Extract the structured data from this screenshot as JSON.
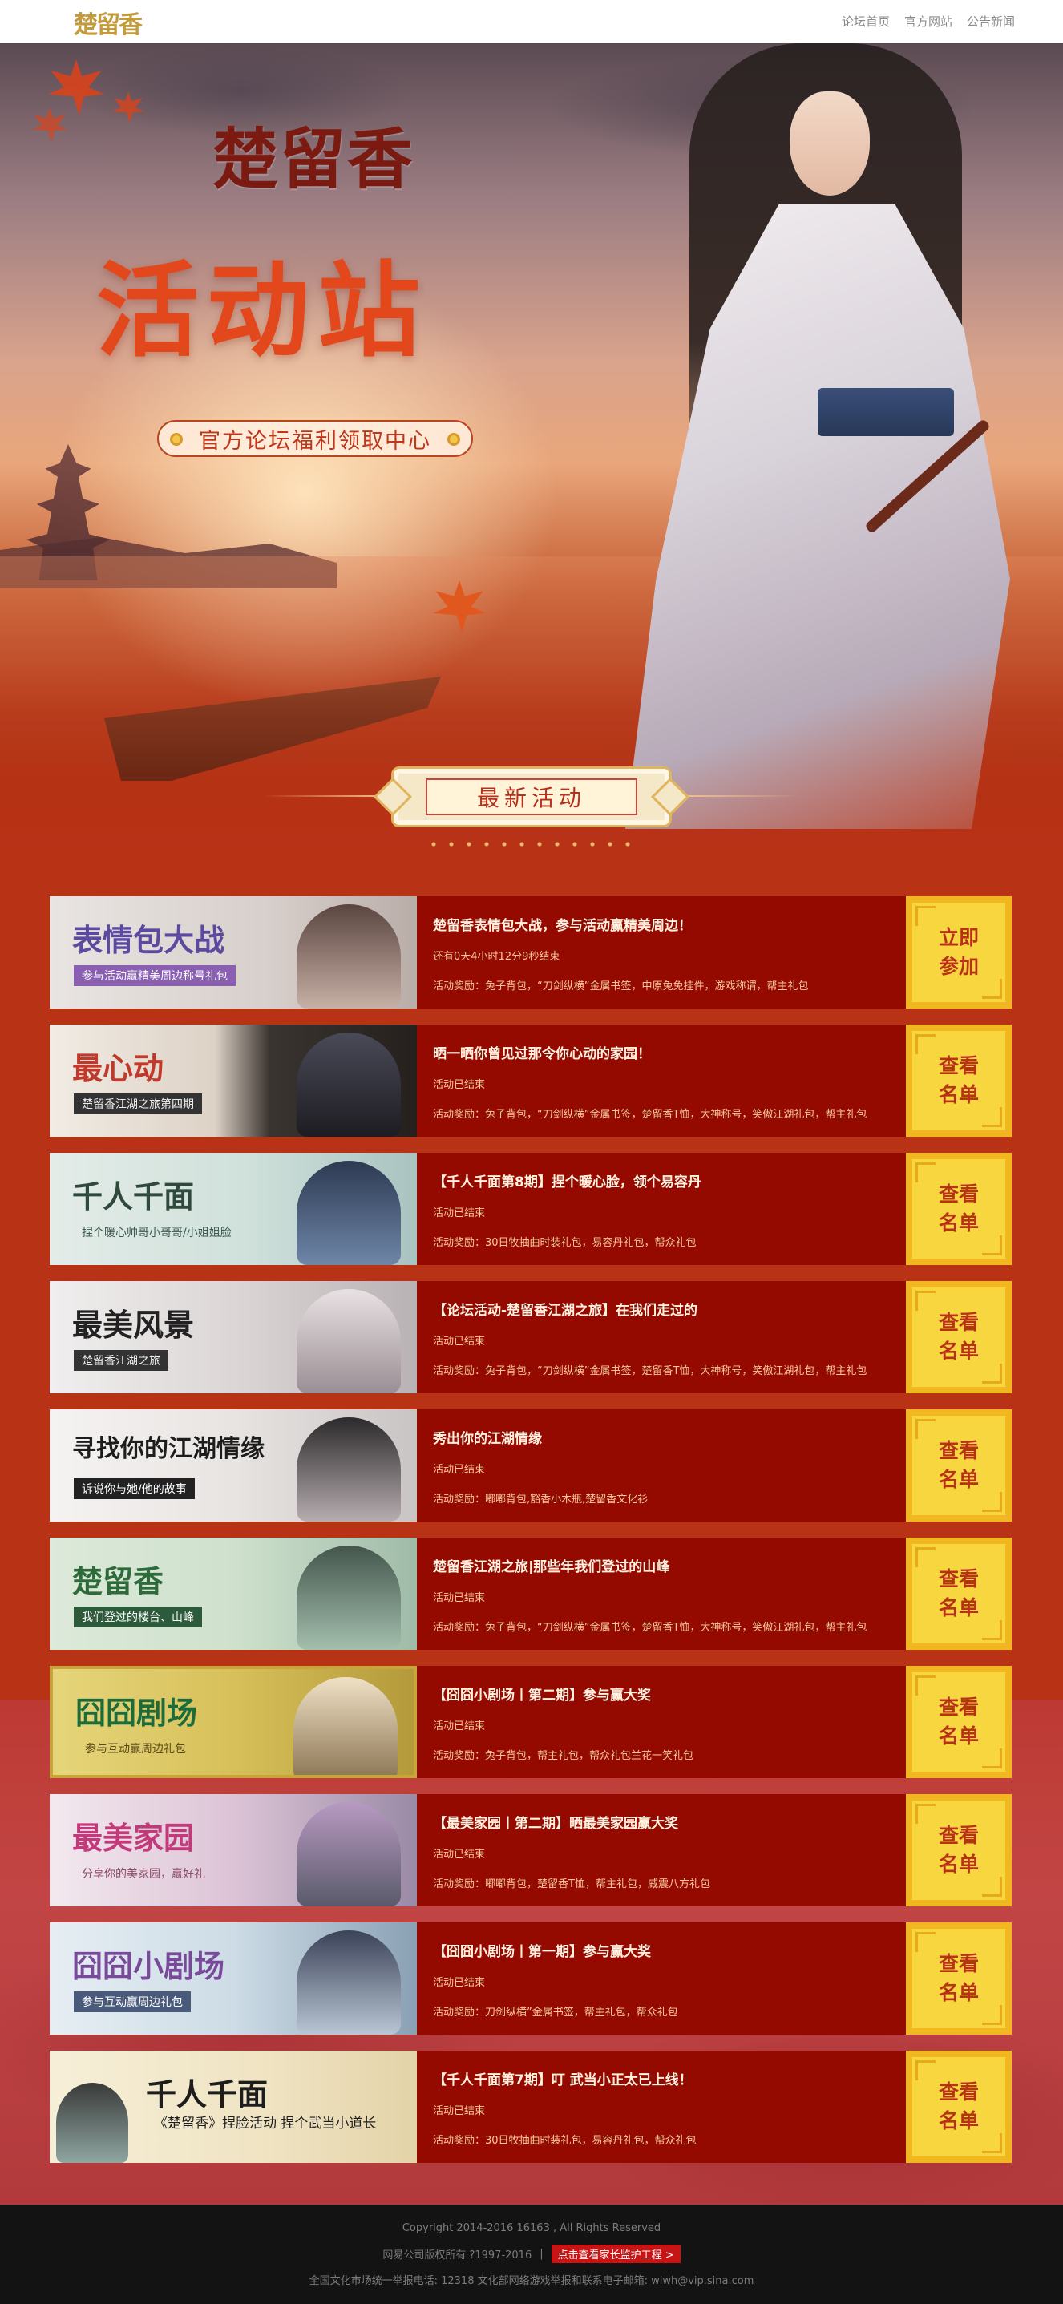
{
  "header": {
    "logo": "楚留香",
    "nav": [
      "论坛首页",
      "官方网站",
      "公告新闻"
    ]
  },
  "hero": {
    "brand": "楚留香",
    "title": "活动站",
    "subtitle": "官方论坛福利领取中心"
  },
  "section": {
    "title": "最新活动"
  },
  "activities": [
    {
      "thumb_title": "表情包大战",
      "thumb_sub": "参与活动赢精美周边称号礼包",
      "title": "楚留香表情包大战，参与活动赢精美周边！",
      "status": "还有0天4小时12分9秒结束",
      "reward": "活动奖励：兔子背包，“刀剑纵横”金属书签，中原兔免挂件，游戏称谓，帮主礼包",
      "cta": "立即参加"
    },
    {
      "thumb_title": "最心动",
      "thumb_sub": "楚留香江湖之旅第四期",
      "title": "晒一晒你曾见过那令你心动的家园！",
      "status": "活动已结束",
      "reward": "活动奖励：兔子背包，“刀剑纵横”金属书签，楚留香T恤，大神称号，笑傲江湖礼包，帮主礼包",
      "cta": "查看名单"
    },
    {
      "thumb_title": "千人千面",
      "thumb_sub": "捏个暖心帅哥小哥哥/小姐姐脸",
      "title": "【千人千面第8期】捏个暖心脸，领个易容丹",
      "status": "活动已结束",
      "reward": "活动奖励：30日牧抽曲时装礼包，易容丹礼包，帮众礼包",
      "cta": "查看名单"
    },
    {
      "thumb_title": "最美风景",
      "thumb_sub": "楚留香江湖之旅",
      "title": "【论坛活动-楚留香江湖之旅】在我们走过的",
      "status": "活动已结束",
      "reward": "活动奖励：兔子背包，“刀剑纵横”金属书签，楚留香T恤，大神称号，笑傲江湖礼包，帮主礼包",
      "cta": "查看名单"
    },
    {
      "thumb_title": "寻找你的江湖情缘",
      "thumb_sub": "诉说你与她/他的故事",
      "title": "秀出你的江湖情缘",
      "status": "活动已结束",
      "reward": "活动奖励：嘟嘟背包,豁香小木瓶,楚留香文化衫",
      "cta": "查看名单"
    },
    {
      "thumb_title": "楚留香",
      "thumb_sub": "我们登过的楼台、山峰",
      "title": "楚留香江湖之旅|那些年我们登过的山峰",
      "status": "活动已结束",
      "reward": "活动奖励：兔子背包，“刀剑纵横”金属书签，楚留香T恤，大神称号，笑傲江湖礼包，帮主礼包",
      "cta": "查看名单"
    },
    {
      "thumb_title": "囧囧剧场",
      "thumb_sub": "参与互动赢周边礼包",
      "title": "【囧囧小剧场丨第二期】参与赢大奖",
      "status": "活动已结束",
      "reward": "活动奖励：兔子背包，帮主礼包，帮众礼包兰花一笑礼包",
      "cta": "查看名单"
    },
    {
      "thumb_title": "最美家园",
      "thumb_sub": "分享你的美家园，赢好礼",
      "title": "【最美家园丨第二期】晒最美家园赢大奖",
      "status": "活动已结束",
      "reward": "活动奖励：嘟嘟背包，楚留香T恤，帮主礼包，威震八方礼包",
      "cta": "查看名单"
    },
    {
      "thumb_title": "囧囧小剧场",
      "thumb_sub": "参与互动赢周边礼包",
      "title": "【囧囧小剧场丨第一期】参与赢大奖",
      "status": "活动已结束",
      "reward": "活动奖励：刀剑纵横”金属书签，帮主礼包，帮众礼包",
      "cta": "查看名单"
    },
    {
      "thumb_title": "千人千面",
      "thumb_sub": "《楚留香》捏脸活动 捏个武当小道长",
      "title": "【千人千面第7期】叮 武当小正太已上线！",
      "status": "活动已结束",
      "reward": "活动奖励：30日牧抽曲时装礼包，易容丹礼包，帮众礼包",
      "cta": "查看名单"
    }
  ],
  "footer": {
    "copyright": "Copyright 2014-2016 16163 , All Rights Reserved",
    "company": "网易公司版权所有 ?1997-2016",
    "guard_button": "点击查看家长监护工程 >",
    "hotline": "全国文化市场统一举报电话: 12318 文化部网络游戏举报和联系电子邮箱: wlwh@vip.sina.com"
  }
}
